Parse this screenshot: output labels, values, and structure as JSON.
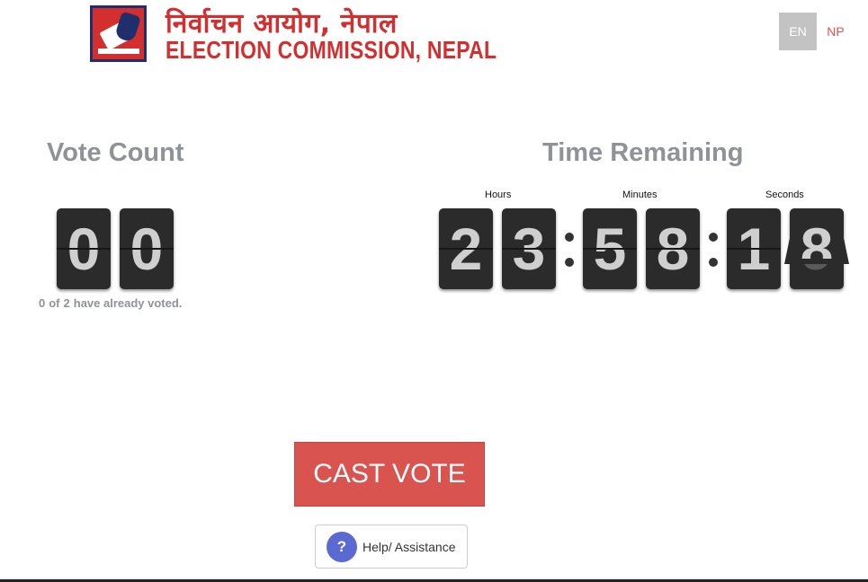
{
  "header": {
    "logo_text_np": "निर्वाचन आयोग, नेपाल",
    "logo_text_en": "ELECTION COMMISSION, NEPAL",
    "logo_icon": "ballot-box-icon"
  },
  "language": {
    "options": [
      "EN",
      "NP"
    ],
    "selected": "EN"
  },
  "vote_count": {
    "title": "Vote Count",
    "digits": [
      "0",
      "0"
    ],
    "note_voted": "0",
    "note_of": "of",
    "note_total": "2",
    "note_suffix": "have already voted."
  },
  "timer": {
    "title": "Time Remaining",
    "hours_label": "Hours",
    "minutes_label": "Minutes",
    "seconds_label": "Seconds",
    "hours": [
      "2",
      "3"
    ],
    "minutes": [
      "5",
      "8"
    ],
    "seconds": [
      "1",
      "8"
    ],
    "seconds_flipping_under": "9"
  },
  "actions": {
    "cast_vote_label": "CAST VOTE",
    "help_label": "Help/ Assistance",
    "help_icon_glyph": "?"
  },
  "colors": {
    "brand_red": "#d32f2f",
    "cast_vote": "#d9534f",
    "help_icon": "#5b6ad0",
    "card": "#2b2b2b",
    "heading_grey": "#8f9296"
  }
}
